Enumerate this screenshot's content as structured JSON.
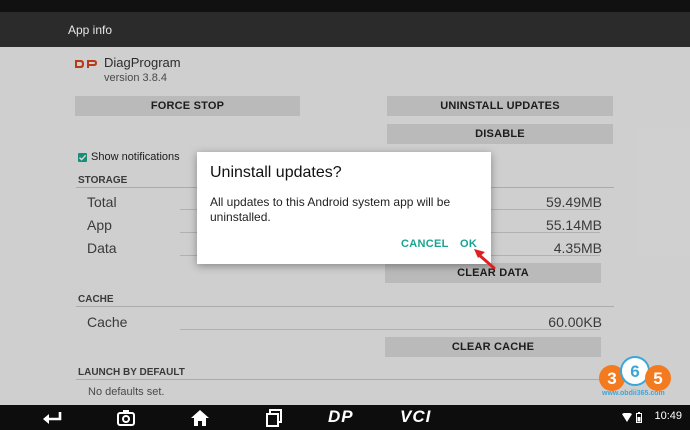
{
  "app_bar": {
    "title": "App info"
  },
  "app": {
    "logo_text": "DP",
    "name": "DiagProgram",
    "version": "version 3.8.4"
  },
  "buttons": {
    "force_stop": "FORCE STOP",
    "uninstall_updates": "UNINSTALL UPDATES",
    "disable": "DISABLE",
    "clear_data": "CLEAR DATA",
    "clear_cache": "CLEAR CACHE"
  },
  "notifications": {
    "label": "Show notifications",
    "checked": true
  },
  "storage": {
    "header": "STORAGE",
    "rows": [
      {
        "label": "Total",
        "value": "59.49MB"
      },
      {
        "label": "App",
        "value": "55.14MB"
      },
      {
        "label": "Data",
        "value": "4.35MB"
      }
    ]
  },
  "cache": {
    "header": "CACHE",
    "label": "Cache",
    "value": "60.00KB"
  },
  "launch": {
    "header": "LAUNCH BY DEFAULT",
    "text": "No defaults set."
  },
  "dialog": {
    "title": "Uninstall updates?",
    "message": "All updates to this Android system app will be uninstalled.",
    "cancel": "CANCEL",
    "ok": "OK"
  },
  "nav": {
    "dp_label": "DP",
    "vci_label": "VCI"
  },
  "status": {
    "time": "10:49"
  },
  "watermark": {
    "number": "365",
    "url": "www.obdii365.com"
  },
  "colors": {
    "accent": "#1aa390",
    "checkbox": "#1fa58a",
    "arrow": "#e02020"
  }
}
